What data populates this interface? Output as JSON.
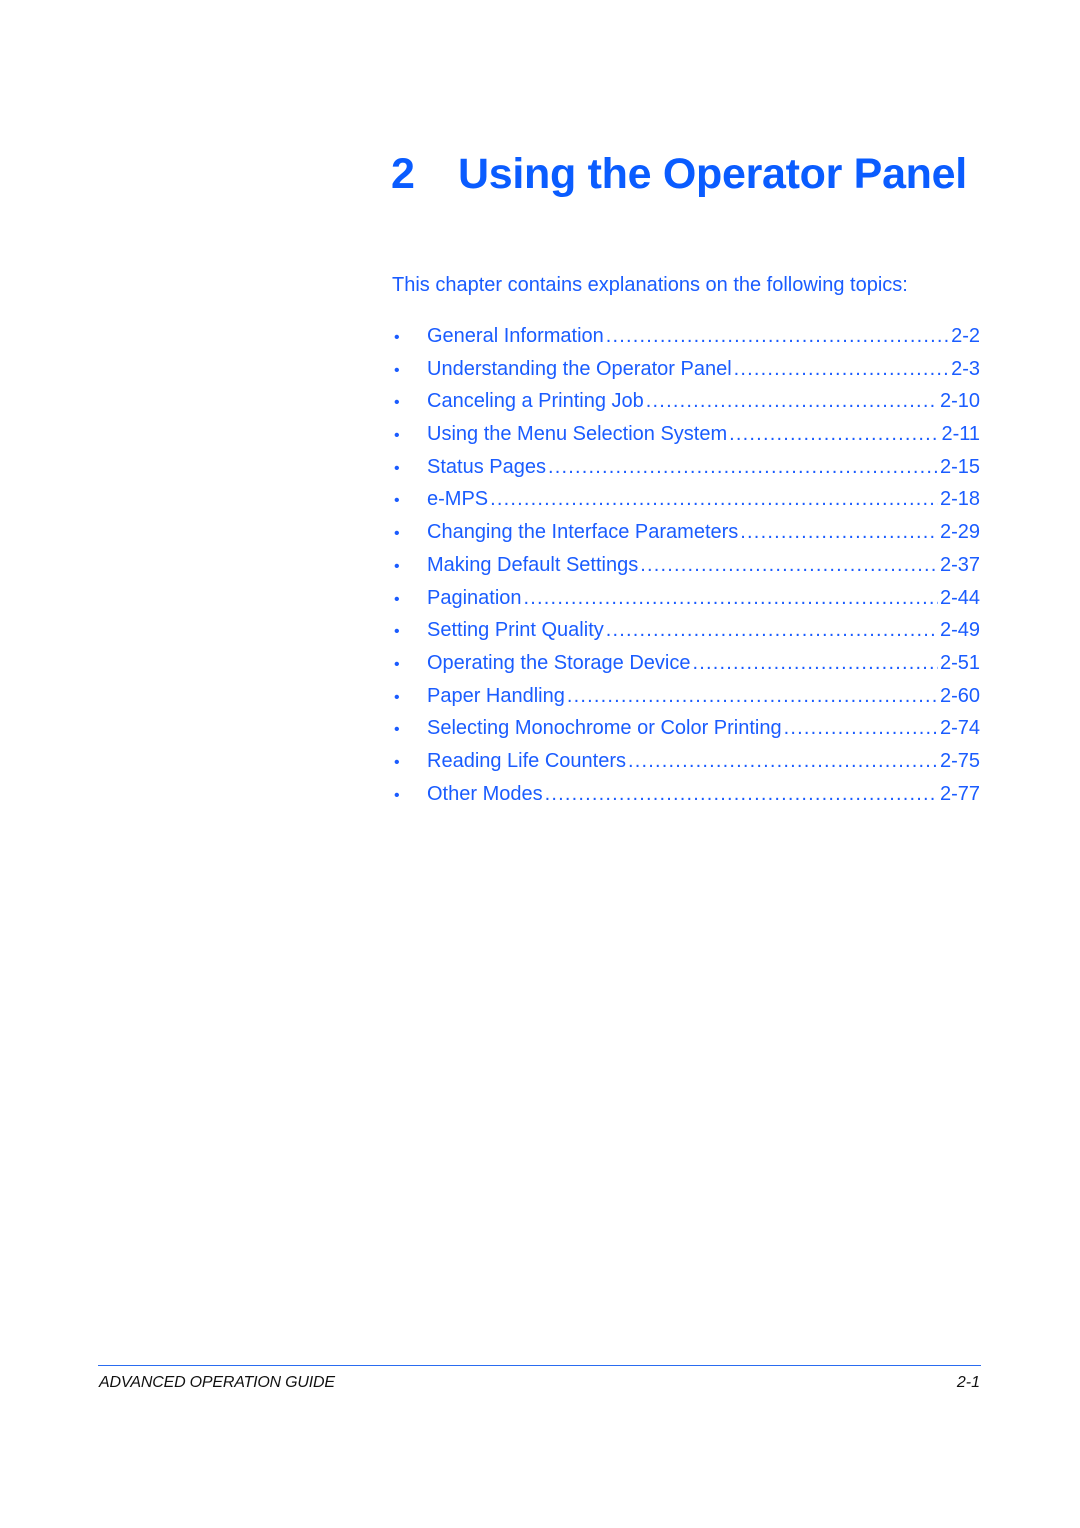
{
  "chapter": {
    "number": "2",
    "title": "Using the Operator Panel"
  },
  "intro": "This chapter contains explanations on the following topics:",
  "toc": [
    {
      "label": "General Information",
      "page": "2-2"
    },
    {
      "label": "Understanding the Operator Panel",
      "page": "2-3"
    },
    {
      "label": "Canceling a Printing Job",
      "page": "2-10"
    },
    {
      "label": "Using the Menu Selection System",
      "page": "2-11"
    },
    {
      "label": "Status Pages",
      "page": "2-15"
    },
    {
      "label": "e-MPS",
      "page": "2-18"
    },
    {
      "label": "Changing the Interface Parameters",
      "page": "2-29"
    },
    {
      "label": "Making Default Settings",
      "page": "2-37"
    },
    {
      "label": "Pagination",
      "page": "2-44"
    },
    {
      "label": "Setting Print Quality",
      "page": "2-49"
    },
    {
      "label": "Operating the Storage Device",
      "page": "2-51"
    },
    {
      "label": "Paper Handling",
      "page": "2-60"
    },
    {
      "label": "Selecting Monochrome or Color Printing",
      "page": "2-74"
    },
    {
      "label": "Reading Life Counters",
      "page": "2-75"
    },
    {
      "label": "Other Modes",
      "page": "2-77"
    }
  ],
  "bullet_glyph": "•",
  "footer": {
    "title": "ADVANCED OPERATION GUIDE",
    "page": "2-1"
  },
  "colors": {
    "accent": "#0a5cff",
    "text_link": "#1a5cff",
    "footer_text": "#111111",
    "footer_rule": "#2a6cf0"
  }
}
